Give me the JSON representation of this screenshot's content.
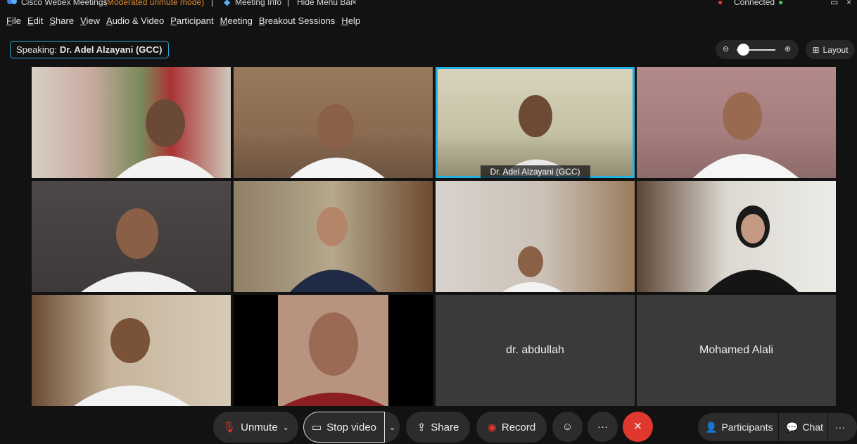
{
  "titlebar": {
    "app_name": "Cisco Webex Meetings",
    "mode": "(Moderated unmute mode)",
    "separator": "|",
    "meeting_info": "Meeting Info",
    "hide_menu": "Hide Menu Bar",
    "connection": "Connected"
  },
  "menu": [
    "File",
    "Edit",
    "Share",
    "View",
    "Audio & Video",
    "Participant",
    "Meeting",
    "Breakout Sessions",
    "Help"
  ],
  "speaking": {
    "label": "Speaking:",
    "name": "Dr. Adel Alzayani (GCC)"
  },
  "layout_label": "Layout",
  "tiles": {
    "active_name": "Dr. Adel Alzayani (GCC)",
    "empty_1": "dr. abdullah",
    "empty_2": "Mohamed Alali"
  },
  "controls": {
    "unmute": "Unmute",
    "stop_video": "Stop video",
    "share": "Share",
    "record": "Record",
    "more": "···",
    "participants": "Participants",
    "chat": "Chat",
    "overflow": "···"
  },
  "colors": {
    "accent": "#22b0e0",
    "leave": "#e0372f",
    "record": "#e0372f",
    "mute": "#e0372f",
    "mode": "#e08a2e"
  }
}
